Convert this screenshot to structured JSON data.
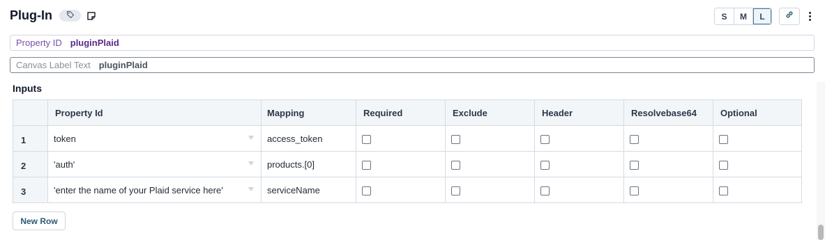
{
  "header": {
    "title": "Plug-In",
    "icons": {
      "tag": "tag-icon",
      "note": "note-icon",
      "link": "link-icon",
      "more": "more-vertical-icon"
    },
    "sizes": [
      {
        "label": "S",
        "active": false
      },
      {
        "label": "M",
        "active": false
      },
      {
        "label": "L",
        "active": true
      }
    ]
  },
  "fields": {
    "property_id": {
      "label": "Property ID",
      "value": "pluginPlaid"
    },
    "canvas_label": {
      "label": "Canvas Label Text",
      "value": "pluginPlaid"
    }
  },
  "inputs": {
    "title": "Inputs",
    "columns": [
      "",
      "Property Id",
      "Mapping",
      "Required",
      "Exclude",
      "Header",
      "Resolvebase64",
      "Optional"
    ],
    "rows": [
      {
        "num": "1",
        "property_id": "token",
        "mapping": "access_token"
      },
      {
        "num": "2",
        "property_id": "'auth'",
        "mapping": "products.[0]"
      },
      {
        "num": "3",
        "property_id": "'enter the name of your Plaid service here'",
        "mapping": "serviceName"
      }
    ],
    "new_row_label": "New Row"
  },
  "colors": {
    "accent": "#2c5a74",
    "property_label": "#7a4ea8",
    "property_value": "#5b2a86"
  }
}
